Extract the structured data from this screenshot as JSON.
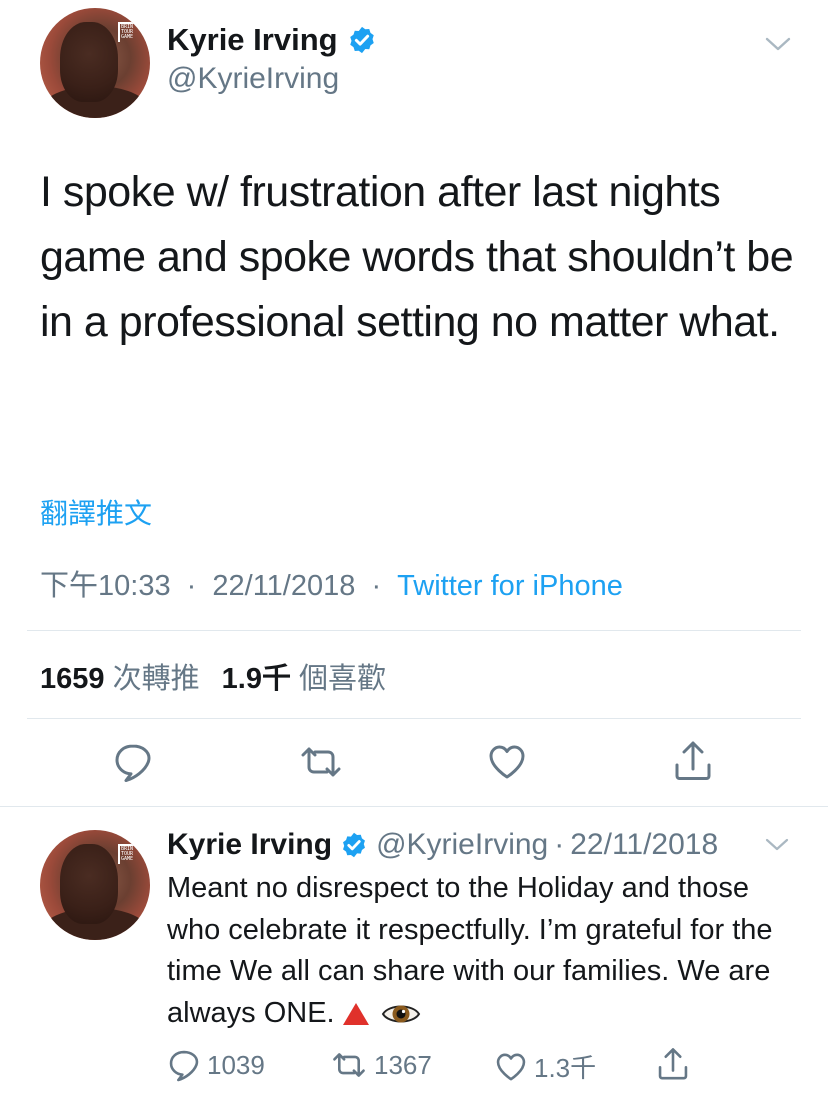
{
  "main_tweet": {
    "display_name": "Kyrie Irving",
    "handle": "@KyrieIrving",
    "text": "I spoke w/ frustration after last nights game and spoke words that shouldn’t be in a professional setting no matter what.",
    "translate_label": "翻譯推文",
    "time": "下午10:33",
    "date": "22/11/2018",
    "separator": "·",
    "client": "Twitter for iPhone",
    "retweet_count": "1659",
    "retweet_label": "次轉推",
    "like_count": "1.9千",
    "like_label": "個喜歡"
  },
  "reply_tweet": {
    "display_name": "Kyrie Irving",
    "handle": "@KyrieIrving",
    "separator": "·",
    "date": "22/11/2018",
    "text": "Meant no disrespect to the Holiday and those who celebrate it respectfully.  I’m grateful for the time We all can share with our families. We are always ONE.",
    "reply_count": "1039",
    "retweet_count": "1367",
    "like_count": "1.3千"
  },
  "colors": {
    "accent": "#1da1f2",
    "secondary_text": "#657786",
    "primary_text": "#14171a",
    "divider": "#e1e8ed"
  },
  "icons": [
    "verified-badge-icon",
    "chevron-down-icon",
    "reply-icon",
    "retweet-icon",
    "like-icon",
    "share-icon",
    "red-triangle-emoji",
    "eye-emoji"
  ]
}
